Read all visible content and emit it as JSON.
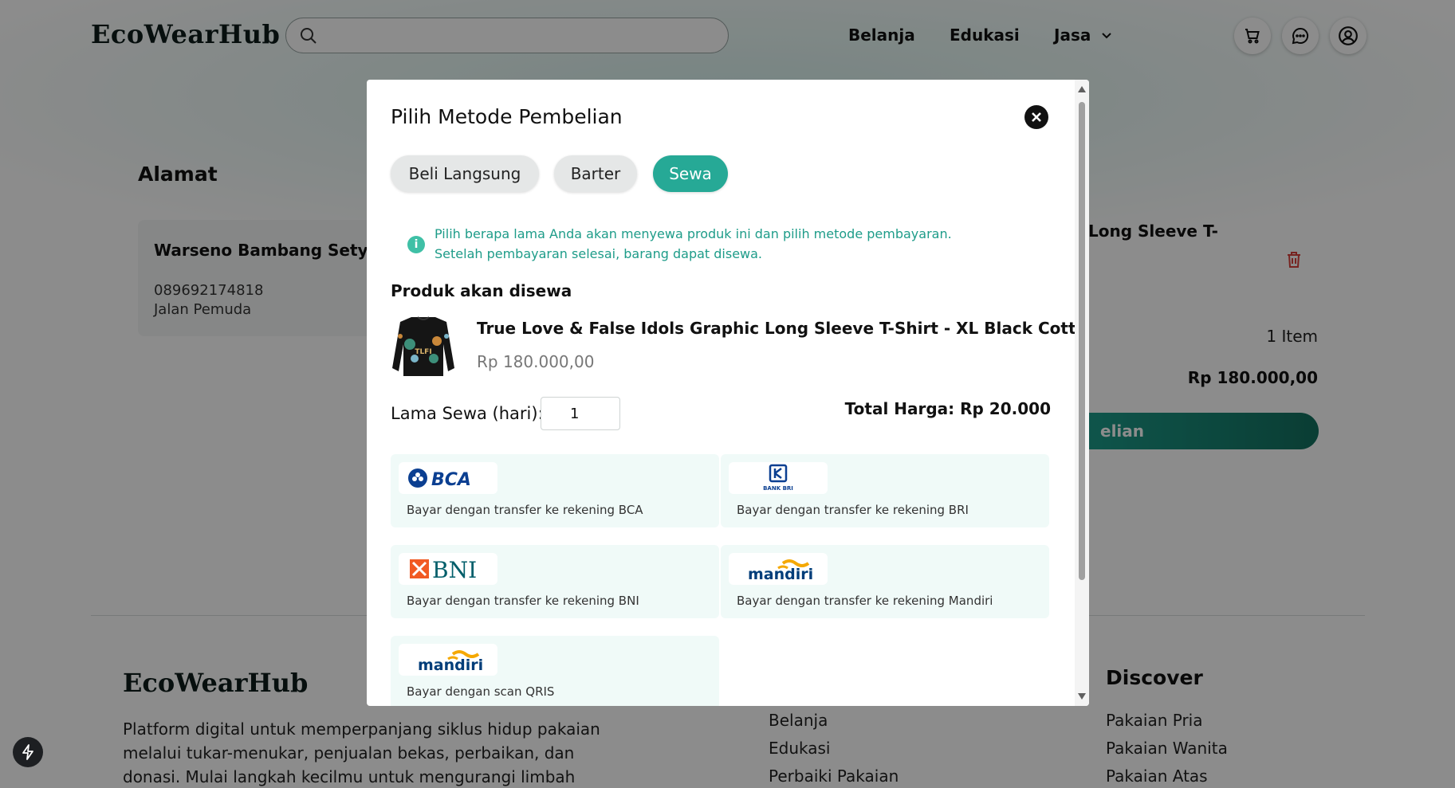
{
  "header": {
    "logo": "EcoWearHub",
    "search_placeholder": "",
    "nav": [
      "Belanja",
      "Edukasi",
      "Jasa"
    ],
    "icons": [
      "cart-icon",
      "chat-icon",
      "user-icon"
    ]
  },
  "checkout": {
    "address_title": "Alamat",
    "address_name": "Warseno Bambang Setyo",
    "address_phone": "089692174818",
    "address_street": "Jalan Pemuda",
    "summary_title": "Long Sleeve T-",
    "item_count": "1 Item",
    "summary_price": "Rp 180.000,00",
    "checkout_button": "elian"
  },
  "footer": {
    "logo": "EcoWearHub",
    "description": "Platform digital untuk memperpanjang siklus hidup pakaian melalui tukar-menukar, penjualan bekas, perbaikan, dan donasi. Mulai langkah kecilmu untuk mengurangi limbah",
    "links": [
      "Belanja",
      "Edukasi",
      "Perbaiki Pakaian"
    ],
    "discover_title": "Discover",
    "discover_links": [
      "Pakaian Pria",
      "Pakaian Wanita",
      "Pakaian Atas"
    ]
  },
  "modal": {
    "title": "Pilih Metode Pembelian",
    "tabs": [
      "Beli Langsung",
      "Barter",
      "Sewa"
    ],
    "active_tab": "Sewa",
    "info_line1": "Pilih berapa lama Anda akan menyewa produk ini dan pilih metode pembayaran.",
    "info_line2": "Setelah pembayaran selesai, barang dapat disewa.",
    "product_heading": "Produk akan disewa",
    "product_name": "True Love & False Idols Graphic Long Sleeve T-Shirt - XL Black Cotton",
    "product_price": "Rp 180.000,00",
    "product_print": "TLFI",
    "rent_label": "Lama Sewa (hari):",
    "rent_days": "1",
    "total": "Total Harga: Rp 20.000",
    "payments": [
      {
        "logo": "BCA",
        "desc": "Bayar dengan transfer ke rekening BCA"
      },
      {
        "logo": "BANK BRI",
        "desc": "Bayar dengan transfer ke rekening BRI"
      },
      {
        "logo": "BNI",
        "desc": "Bayar dengan transfer ke rekening BNI"
      },
      {
        "logo": "mandiri",
        "desc": "Bayar dengan transfer ke rekening Mandiri"
      },
      {
        "logo": "mandiri",
        "desc": "Bayar dengan scan QRIS"
      }
    ]
  },
  "colors": {
    "accent": "#26a996",
    "info_text": "#1e9c89",
    "bca_blue": "#0b3f91",
    "bni_orange": "#f15a23",
    "bni_teal": "#005e6a",
    "mandiri_navy": "#003d79",
    "mandiri_gold": "#f5a800"
  }
}
